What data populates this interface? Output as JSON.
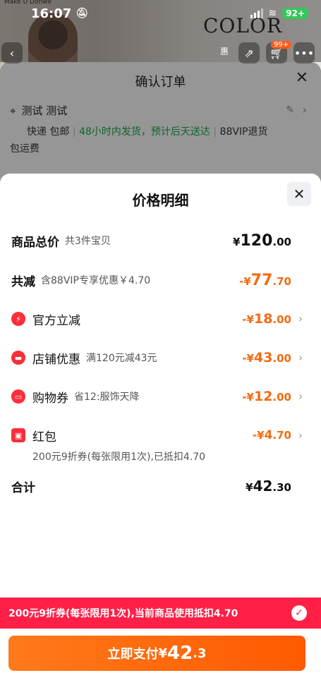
{
  "status_bar": {
    "time": "16:07",
    "battery": "92+"
  },
  "background": {
    "brand_text": "COLOR",
    "tiny_text": "Make U Donwe",
    "cart_badge": "99+",
    "action_label": "惠"
  },
  "order_sheet": {
    "title": "确认订单",
    "recipient": "测试 测试",
    "delivery": "快递 包邮",
    "ship_note": "48小时内发货，预计后天送达",
    "vip_return": "88VIP退货",
    "return_shipping": "包运费"
  },
  "price_sheet": {
    "title": "价格明细",
    "rows": [
      {
        "label": "商品总价",
        "sub": "共3件宝贝",
        "currency": "¥",
        "int": "120",
        "dec": ".00"
      },
      {
        "label": "共减",
        "sub": "含88VIP专享优惠￥4.70",
        "currency": "-¥",
        "int": "77",
        "dec": ".70"
      },
      {
        "label": "官方立减",
        "sub": "",
        "currency": "-¥",
        "int": "18",
        "dec": ".00"
      },
      {
        "label": "店铺优惠",
        "sub": "满120元减43元",
        "currency": "-¥",
        "int": "43",
        "dec": ".00"
      },
      {
        "label": "购物券",
        "sub": "省12:服饰天降",
        "currency": "-¥",
        "int": "12",
        "dec": ".00"
      },
      {
        "label": "红包",
        "sub": "",
        "currency": "-¥",
        "int": "4",
        "dec": ".70"
      },
      {
        "label": "合计",
        "sub": "",
        "currency": "¥",
        "int": "42",
        "dec": ".30"
      }
    ],
    "coupon_desc": "200元9折券(每张限用1次),已抵扣4.70",
    "promo_bar": "200元9折券(每张限用1次),当前商品使用抵扣4.70",
    "pay_button": {
      "label": "立即支付",
      "currency": "¥",
      "int": "42",
      "dec": ".3"
    }
  },
  "colors": {
    "accent_orange": "#f26b12",
    "promo_red": "#ff1f47",
    "vip_green": "#16a34a"
  }
}
